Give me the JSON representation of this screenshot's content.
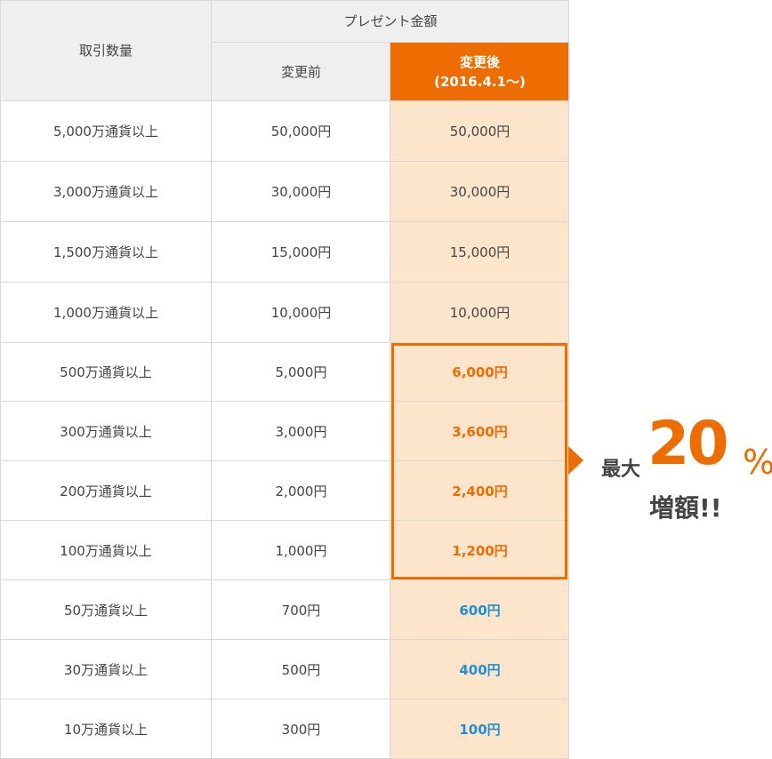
{
  "header": {
    "col1": "取引数量",
    "group": "プレゼント金額",
    "col2": "変更前",
    "col3_line1": "変更後",
    "col3_line2": "(2016.4.1〜)"
  },
  "rows": [
    {
      "qty": "5,000万通貨以上",
      "before": "50,000円",
      "after": "50,000円",
      "style": "plain"
    },
    {
      "qty": "3,000万通貨以上",
      "before": "30,000円",
      "after": "30,000円",
      "style": "plain"
    },
    {
      "qty": "1,500万通貨以上",
      "before": "15,000円",
      "after": "15,000円",
      "style": "plain"
    },
    {
      "qty": "1,000万通貨以上",
      "before": "10,000円",
      "after": "10,000円",
      "style": "plain"
    },
    {
      "qty": "500万通貨以上",
      "before": "5,000円",
      "after": "6,000円",
      "style": "orange"
    },
    {
      "qty": "300万通貨以上",
      "before": "3,000円",
      "after": "3,600円",
      "style": "orange"
    },
    {
      "qty": "200万通貨以上",
      "before": "2,000円",
      "after": "2,400円",
      "style": "orange"
    },
    {
      "qty": "100万通貨以上",
      "before": "1,000円",
      "after": "1,200円",
      "style": "orange"
    },
    {
      "qty": "50万通貨以上",
      "before": "700円",
      "after": "600円",
      "style": "blue"
    },
    {
      "qty": "30万通貨以上",
      "before": "500円",
      "after": "400円",
      "style": "blue"
    },
    {
      "qty": "10万通貨以上",
      "before": "300円",
      "after": "100円",
      "style": "blue"
    }
  ],
  "callout": {
    "max": "最大",
    "number": "20",
    "percent": "%",
    "increase": "増額!!"
  },
  "colors": {
    "accent_orange": "#ed6d00",
    "highlight_bg": "#fde5cc",
    "blue_text": "#1f8fd6",
    "header_bg": "#efefef"
  }
}
